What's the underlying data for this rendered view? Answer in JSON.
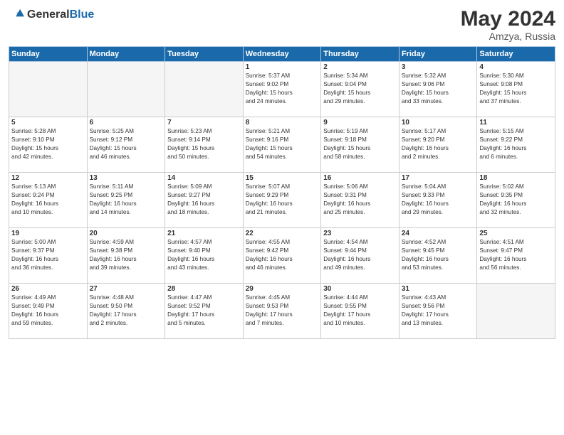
{
  "header": {
    "logo_general": "General",
    "logo_blue": "Blue",
    "title": "May 2024",
    "subtitle": "Amzya, Russia"
  },
  "weekdays": [
    "Sunday",
    "Monday",
    "Tuesday",
    "Wednesday",
    "Thursday",
    "Friday",
    "Saturday"
  ],
  "weeks": [
    [
      {
        "day": "",
        "empty": true
      },
      {
        "day": "",
        "empty": true
      },
      {
        "day": "",
        "empty": true
      },
      {
        "day": "1",
        "info": "Sunrise: 5:37 AM\nSunset: 9:02 PM\nDaylight: 15 hours\nand 24 minutes."
      },
      {
        "day": "2",
        "info": "Sunrise: 5:34 AM\nSunset: 9:04 PM\nDaylight: 15 hours\nand 29 minutes."
      },
      {
        "day": "3",
        "info": "Sunrise: 5:32 AM\nSunset: 9:06 PM\nDaylight: 15 hours\nand 33 minutes."
      },
      {
        "day": "4",
        "info": "Sunrise: 5:30 AM\nSunset: 9:08 PM\nDaylight: 15 hours\nand 37 minutes."
      }
    ],
    [
      {
        "day": "5",
        "info": "Sunrise: 5:28 AM\nSunset: 9:10 PM\nDaylight: 15 hours\nand 42 minutes."
      },
      {
        "day": "6",
        "info": "Sunrise: 5:25 AM\nSunset: 9:12 PM\nDaylight: 15 hours\nand 46 minutes."
      },
      {
        "day": "7",
        "info": "Sunrise: 5:23 AM\nSunset: 9:14 PM\nDaylight: 15 hours\nand 50 minutes."
      },
      {
        "day": "8",
        "info": "Sunrise: 5:21 AM\nSunset: 9:16 PM\nDaylight: 15 hours\nand 54 minutes."
      },
      {
        "day": "9",
        "info": "Sunrise: 5:19 AM\nSunset: 9:18 PM\nDaylight: 15 hours\nand 58 minutes."
      },
      {
        "day": "10",
        "info": "Sunrise: 5:17 AM\nSunset: 9:20 PM\nDaylight: 16 hours\nand 2 minutes."
      },
      {
        "day": "11",
        "info": "Sunrise: 5:15 AM\nSunset: 9:22 PM\nDaylight: 16 hours\nand 6 minutes."
      }
    ],
    [
      {
        "day": "12",
        "info": "Sunrise: 5:13 AM\nSunset: 9:24 PM\nDaylight: 16 hours\nand 10 minutes."
      },
      {
        "day": "13",
        "info": "Sunrise: 5:11 AM\nSunset: 9:25 PM\nDaylight: 16 hours\nand 14 minutes."
      },
      {
        "day": "14",
        "info": "Sunrise: 5:09 AM\nSunset: 9:27 PM\nDaylight: 16 hours\nand 18 minutes."
      },
      {
        "day": "15",
        "info": "Sunrise: 5:07 AM\nSunset: 9:29 PM\nDaylight: 16 hours\nand 21 minutes."
      },
      {
        "day": "16",
        "info": "Sunrise: 5:06 AM\nSunset: 9:31 PM\nDaylight: 16 hours\nand 25 minutes."
      },
      {
        "day": "17",
        "info": "Sunrise: 5:04 AM\nSunset: 9:33 PM\nDaylight: 16 hours\nand 29 minutes."
      },
      {
        "day": "18",
        "info": "Sunrise: 5:02 AM\nSunset: 9:35 PM\nDaylight: 16 hours\nand 32 minutes."
      }
    ],
    [
      {
        "day": "19",
        "info": "Sunrise: 5:00 AM\nSunset: 9:37 PM\nDaylight: 16 hours\nand 36 minutes."
      },
      {
        "day": "20",
        "info": "Sunrise: 4:59 AM\nSunset: 9:38 PM\nDaylight: 16 hours\nand 39 minutes."
      },
      {
        "day": "21",
        "info": "Sunrise: 4:57 AM\nSunset: 9:40 PM\nDaylight: 16 hours\nand 43 minutes."
      },
      {
        "day": "22",
        "info": "Sunrise: 4:55 AM\nSunset: 9:42 PM\nDaylight: 16 hours\nand 46 minutes."
      },
      {
        "day": "23",
        "info": "Sunrise: 4:54 AM\nSunset: 9:44 PM\nDaylight: 16 hours\nand 49 minutes."
      },
      {
        "day": "24",
        "info": "Sunrise: 4:52 AM\nSunset: 9:45 PM\nDaylight: 16 hours\nand 53 minutes."
      },
      {
        "day": "25",
        "info": "Sunrise: 4:51 AM\nSunset: 9:47 PM\nDaylight: 16 hours\nand 56 minutes."
      }
    ],
    [
      {
        "day": "26",
        "info": "Sunrise: 4:49 AM\nSunset: 9:49 PM\nDaylight: 16 hours\nand 59 minutes."
      },
      {
        "day": "27",
        "info": "Sunrise: 4:48 AM\nSunset: 9:50 PM\nDaylight: 17 hours\nand 2 minutes."
      },
      {
        "day": "28",
        "info": "Sunrise: 4:47 AM\nSunset: 9:52 PM\nDaylight: 17 hours\nand 5 minutes."
      },
      {
        "day": "29",
        "info": "Sunrise: 4:45 AM\nSunset: 9:53 PM\nDaylight: 17 hours\nand 7 minutes."
      },
      {
        "day": "30",
        "info": "Sunrise: 4:44 AM\nSunset: 9:55 PM\nDaylight: 17 hours\nand 10 minutes."
      },
      {
        "day": "31",
        "info": "Sunrise: 4:43 AM\nSunset: 9:56 PM\nDaylight: 17 hours\nand 13 minutes."
      },
      {
        "day": "",
        "empty": true
      }
    ]
  ]
}
